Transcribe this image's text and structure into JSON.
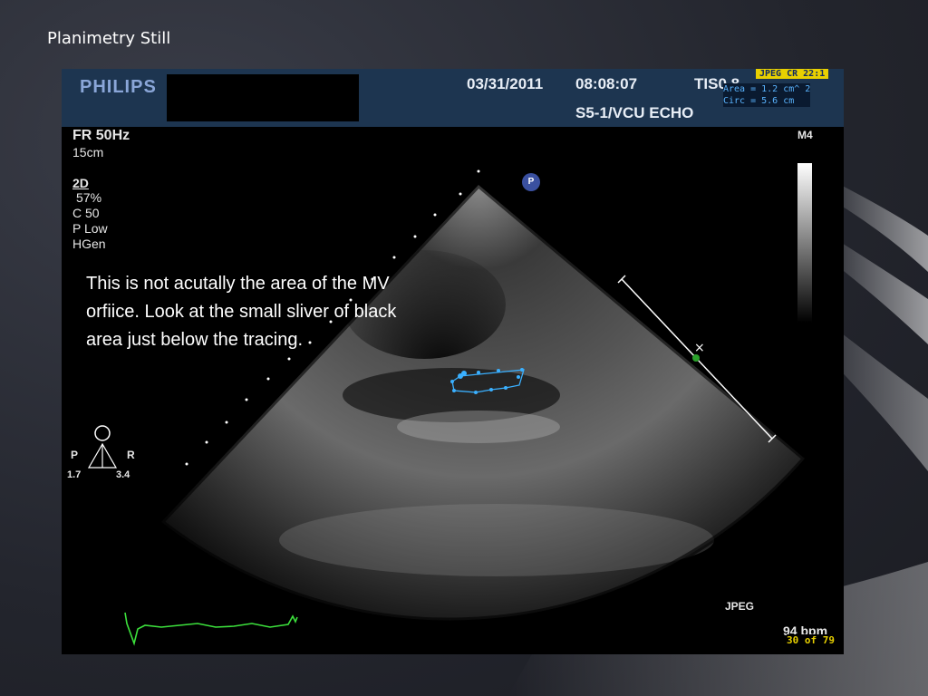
{
  "slide": {
    "title": "Planimetry Still"
  },
  "echo": {
    "brand": "PHILIPS",
    "date": "03/31/2011",
    "time": "08:08:07",
    "tis": "TIS0.8",
    "probe": "S5-1/VCU ECHO",
    "compression": "JPEG CR 22:1",
    "area": "Area = 1.2 cm^ 2",
    "circ": "Circ = 5.6 cm",
    "frame_rate": "FR 50Hz",
    "depth": "15cm",
    "mode": "2D",
    "gain": "57%",
    "compress": "C 50",
    "power": "P Low",
    "freq": "HGen",
    "marker_label": "M4",
    "orientation": {
      "left": "P",
      "right": "R",
      "left_val": "1.7",
      "right_val": "3.4"
    },
    "jpeg_label": "JPEG",
    "heart_rate": "94 bpm",
    "frame_counter": "30 of 79",
    "p_marker": "P"
  },
  "note": "This is not acutally the area of the MV orfiice.  Look at the small sliver of black area just below the tracing.",
  "colors": {
    "header_bg": "#1d3550",
    "trace_color": "#3ab0ff",
    "ecg_color": "#3ce03c",
    "counter_color": "#e8d000"
  }
}
